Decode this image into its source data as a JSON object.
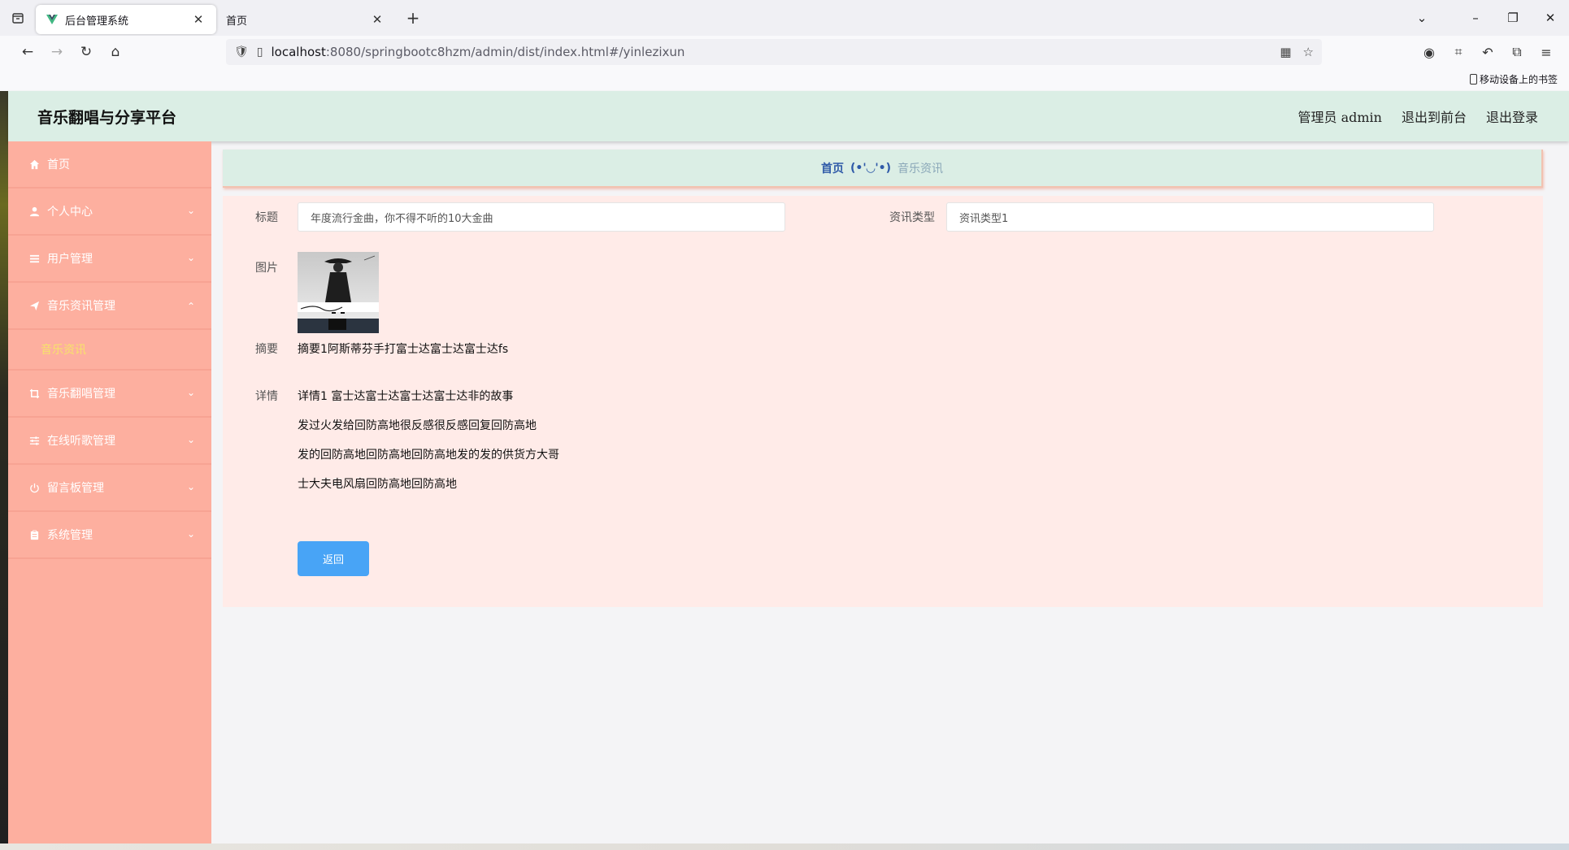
{
  "browser": {
    "tabs": [
      {
        "title": "后台管理系统",
        "active": true
      },
      {
        "title": "首页",
        "active": false
      }
    ],
    "url_host": "localhost",
    "url_rest": ":8080/springbootc8hzm/admin/dist/index.html#/yinlezixun",
    "bookmark_mobile": "移动设备上的书签"
  },
  "header": {
    "title": "音乐翻唱与分享平台",
    "admin_label": "管理员 admin",
    "to_front": "退出到前台",
    "logout": "退出登录"
  },
  "sidebar": {
    "items": [
      {
        "label": "首页",
        "icon": "home-icon"
      },
      {
        "label": "个人中心",
        "icon": "user-icon",
        "expandable": true
      },
      {
        "label": "用户管理",
        "icon": "list-icon",
        "expandable": true
      },
      {
        "label": "音乐资讯管理",
        "icon": "send-icon",
        "expandable": true,
        "expanded": true
      },
      {
        "label": "音乐翻唱管理",
        "icon": "crop-icon",
        "expandable": true
      },
      {
        "label": "在线听歌管理",
        "icon": "sliders-icon",
        "expandable": true
      },
      {
        "label": "留言板管理",
        "icon": "power-icon",
        "expandable": true
      },
      {
        "label": "系统管理",
        "icon": "clipboard-icon",
        "expandable": true
      }
    ],
    "subitem_active": "音乐资讯"
  },
  "breadcrumb": {
    "home": "首页",
    "separator": "(•'◡'•)",
    "current": "音乐资讯"
  },
  "form": {
    "title_label": "标题",
    "title_value": "年度流行金曲，你不得不听的10大金曲",
    "type_label": "资讯类型",
    "type_value": "资讯类型1",
    "image_label": "图片",
    "summary_label": "摘要",
    "summary_value": "摘要1阿斯蒂芬手打富士达富士达富士达fs",
    "detail_label": "详情",
    "detail_lines": [
      "详情1 富士达富士达富士达富士达非的故事",
      "发过火发给回防高地很反感很反感回复回防高地",
      "发的回防高地回防高地回防高地发的发的供货方大哥",
      "士大夫电风扇回防高地回防高地"
    ],
    "back_label": "返回"
  },
  "colors": {
    "header_bg": "#dbeee5",
    "sidebar_bg": "#fdaf9f",
    "card_bg": "#ffebe8",
    "button_bg": "#48a4f6",
    "active_sub": "#f7e36a"
  }
}
